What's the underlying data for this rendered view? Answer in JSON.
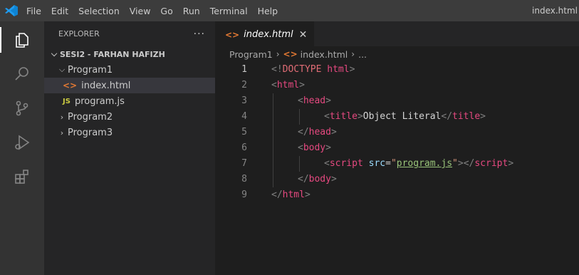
{
  "menu": {
    "items": [
      "File",
      "Edit",
      "Selection",
      "View",
      "Go",
      "Run",
      "Terminal",
      "Help"
    ],
    "window_title": "index.html"
  },
  "activity_bar": {
    "icons": [
      "explorer-icon",
      "search-icon",
      "source-control-icon",
      "run-debug-icon",
      "extensions-icon"
    ]
  },
  "sidebar": {
    "header": "EXPLORER",
    "more_actions": "···",
    "folder": "SESI2 - FARHAN HAFIZH",
    "tree": [
      {
        "label": "Program1",
        "type": "folder",
        "expanded": true
      },
      {
        "label": "index.html",
        "type": "html",
        "selected": true
      },
      {
        "label": "program.js",
        "type": "js",
        "badge": "JS"
      },
      {
        "label": "Program2",
        "type": "folder",
        "expanded": false
      },
      {
        "label": "Program3",
        "type": "folder",
        "expanded": false
      }
    ]
  },
  "editor": {
    "tab": {
      "label": "index.html",
      "close": "✕",
      "icon": "<>"
    },
    "breadcrumb": {
      "folder": "Program1",
      "file": "index.html",
      "rest": "..."
    },
    "lines": [
      {
        "num": "1",
        "indent": 0,
        "tokens": [
          [
            "<!",
            "b"
          ],
          [
            "DOCTYPE",
            "doc"
          ],
          [
            " ",
            "text"
          ],
          [
            "html",
            "tag"
          ],
          [
            ">",
            "b"
          ]
        ]
      },
      {
        "num": "2",
        "indent": 0,
        "tokens": [
          [
            "<",
            "b"
          ],
          [
            "html",
            "tag"
          ],
          [
            ">",
            "b"
          ]
        ]
      },
      {
        "num": "3",
        "indent": 1,
        "tokens": [
          [
            "<",
            "b"
          ],
          [
            "head",
            "tag"
          ],
          [
            ">",
            "b"
          ]
        ]
      },
      {
        "num": "4",
        "indent": 2,
        "tokens": [
          [
            "<",
            "b"
          ],
          [
            "title",
            "tag"
          ],
          [
            ">",
            "b"
          ],
          [
            "Object Literal",
            "text"
          ],
          [
            "</",
            "b"
          ],
          [
            "title",
            "tag"
          ],
          [
            ">",
            "b"
          ]
        ]
      },
      {
        "num": "5",
        "indent": 1,
        "tokens": [
          [
            "</",
            "b"
          ],
          [
            "head",
            "tag"
          ],
          [
            ">",
            "b"
          ]
        ]
      },
      {
        "num": "6",
        "indent": 1,
        "tokens": [
          [
            "<",
            "b"
          ],
          [
            "body",
            "tag"
          ],
          [
            ">",
            "b"
          ]
        ]
      },
      {
        "num": "7",
        "indent": 2,
        "tokens": [
          [
            "<",
            "b"
          ],
          [
            "script",
            "tag"
          ],
          [
            " ",
            "text"
          ],
          [
            "src",
            "attr"
          ],
          [
            "=",
            "text"
          ],
          [
            "\"",
            "str"
          ],
          [
            "program.js",
            "link"
          ],
          [
            "\"",
            "str"
          ],
          [
            "></",
            "b"
          ],
          [
            "script",
            "tag"
          ],
          [
            ">",
            "b"
          ]
        ]
      },
      {
        "num": "8",
        "indent": 1,
        "tokens": [
          [
            "</",
            "b"
          ],
          [
            "body",
            "tag"
          ],
          [
            ">",
            "b"
          ]
        ]
      },
      {
        "num": "9",
        "indent": 0,
        "tokens": [
          [
            "</",
            "b"
          ],
          [
            "html",
            "tag"
          ],
          [
            ">",
            "b"
          ]
        ]
      }
    ],
    "current_line": "1"
  },
  "colors": {
    "accent": "#0078d4",
    "tag": "#e64980",
    "attr": "#9cdcfe",
    "string": "#ce9178",
    "link": "#98c379"
  }
}
